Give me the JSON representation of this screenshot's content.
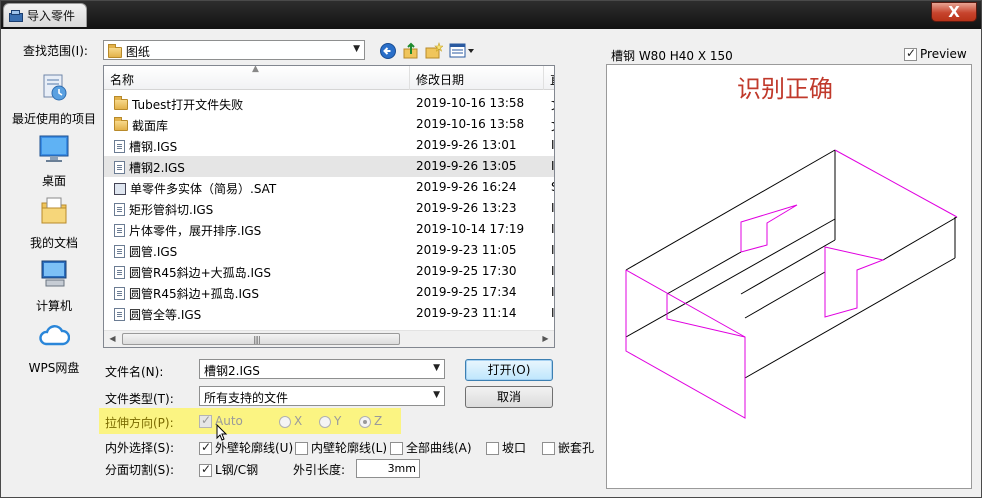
{
  "window": {
    "title": "导入零件",
    "close_glyph": "X"
  },
  "lookin": {
    "label": "查找范围(I):",
    "value": "图纸",
    "toolbar": [
      "back-icon",
      "up-folder-icon",
      "new-folder-icon",
      "view-menu-icon"
    ]
  },
  "places": [
    {
      "label": "最近使用的项目",
      "icon": "recent-items-icon"
    },
    {
      "label": "桌面",
      "icon": "desktop-icon"
    },
    {
      "label": "我的文档",
      "icon": "documents-icon"
    },
    {
      "label": "计算机",
      "icon": "computer-icon"
    },
    {
      "label": "WPS网盘",
      "icon": "cloud-icon"
    }
  ],
  "filelist": {
    "columns": [
      "名称",
      "修改日期",
      "直"
    ],
    "rows": [
      {
        "name": "Tubest打开文件失败",
        "date": "2019-10-16 13:58",
        "type": "folder",
        "extra": "文"
      },
      {
        "name": "截面库",
        "date": "2019-10-16 13:58",
        "type": "folder",
        "extra": "文"
      },
      {
        "name": "槽钢.IGS",
        "date": "2019-9-26 13:01",
        "type": "file",
        "extra": "I"
      },
      {
        "name": "槽钢2.IGS",
        "date": "2019-9-26 13:05",
        "type": "file",
        "extra": "I",
        "selected": true
      },
      {
        "name": "单零件多实体（简易）.SAT",
        "date": "2019-9-26 16:24",
        "type": "sat",
        "extra": "S"
      },
      {
        "name": "矩形管斜切.IGS",
        "date": "2019-9-26 13:23",
        "type": "file",
        "extra": "I"
      },
      {
        "name": "片体零件，展开排序.IGS",
        "date": "2019-10-14 17:19",
        "type": "file",
        "extra": "I"
      },
      {
        "name": "圆管.IGS",
        "date": "2019-9-23 11:05",
        "type": "file",
        "extra": "I"
      },
      {
        "name": "圆管R45斜边+大孤岛.IGS",
        "date": "2019-9-25 17:30",
        "type": "file",
        "extra": "I"
      },
      {
        "name": "圆管R45斜边+孤岛.IGS",
        "date": "2019-9-25 17:34",
        "type": "file",
        "extra": "I"
      },
      {
        "name": "圆管全等.IGS",
        "date": "2019-9-23 11:14",
        "type": "file",
        "extra": "I"
      }
    ]
  },
  "filename": {
    "label": "文件名(N):",
    "value": "槽钢2.IGS"
  },
  "filetype": {
    "label": "文件类型(T):",
    "value": "所有支持的文件"
  },
  "buttons": {
    "open": "打开(O)",
    "cancel": "取消"
  },
  "stretch": {
    "label": "拉伸方向(P):",
    "auto": "Auto",
    "x": "X",
    "y": "Y",
    "z": "Z",
    "auto_checked": true,
    "selected_axis": "Z"
  },
  "inout": {
    "label": "内外选择(S):",
    "outer": "外壁轮廓线(U)",
    "inner": "内壁轮廓线(L)",
    "allcurves": "全部曲线(A)",
    "groove": "坡口",
    "nest": "嵌套孔",
    "outer_checked": true,
    "inner_checked": false,
    "allcurves_checked": false,
    "groove_checked": false,
    "nest_checked": false
  },
  "split": {
    "label": "分面切割(S):",
    "option": "L钢/C钢",
    "option_checked": true
  },
  "extlen": {
    "label": "外引长度:",
    "value": "3mm"
  },
  "preview": {
    "part_label": "槽钢 W80 H40 X 150",
    "checkbox_label": "Preview",
    "checked": true,
    "annotation": "识别正确",
    "annotation_color": "#c0392b",
    "edge_color": "#000000",
    "profile_color": "#e000e0"
  }
}
